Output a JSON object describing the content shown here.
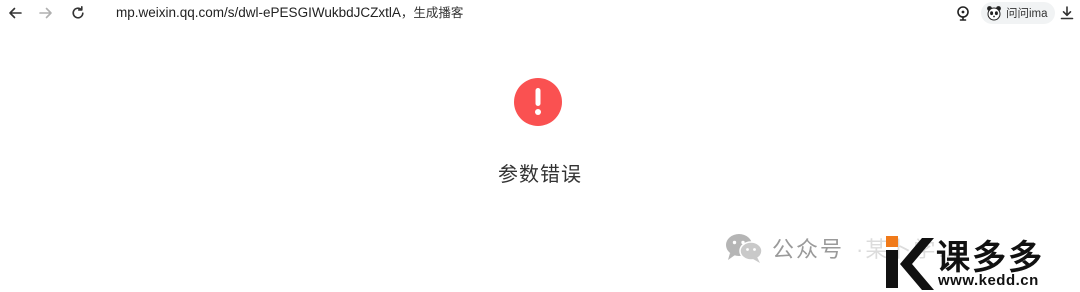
{
  "browser": {
    "url": "mp.weixin.qq.com/s/dwl-ePESGIWukbdJCZxtlA",
    "url_suffix": "，生成播客",
    "ima_label": "问问ima"
  },
  "error": {
    "symbol": "!",
    "message": "参数错误"
  },
  "watermark": {
    "label": "公众号",
    "faded": "·某卜学…"
  },
  "logo": {
    "name": "课多多",
    "url": "www.kedd.cn"
  },
  "colors": {
    "error_red": "#fa5151",
    "logo_orange": "#f07a1a"
  }
}
